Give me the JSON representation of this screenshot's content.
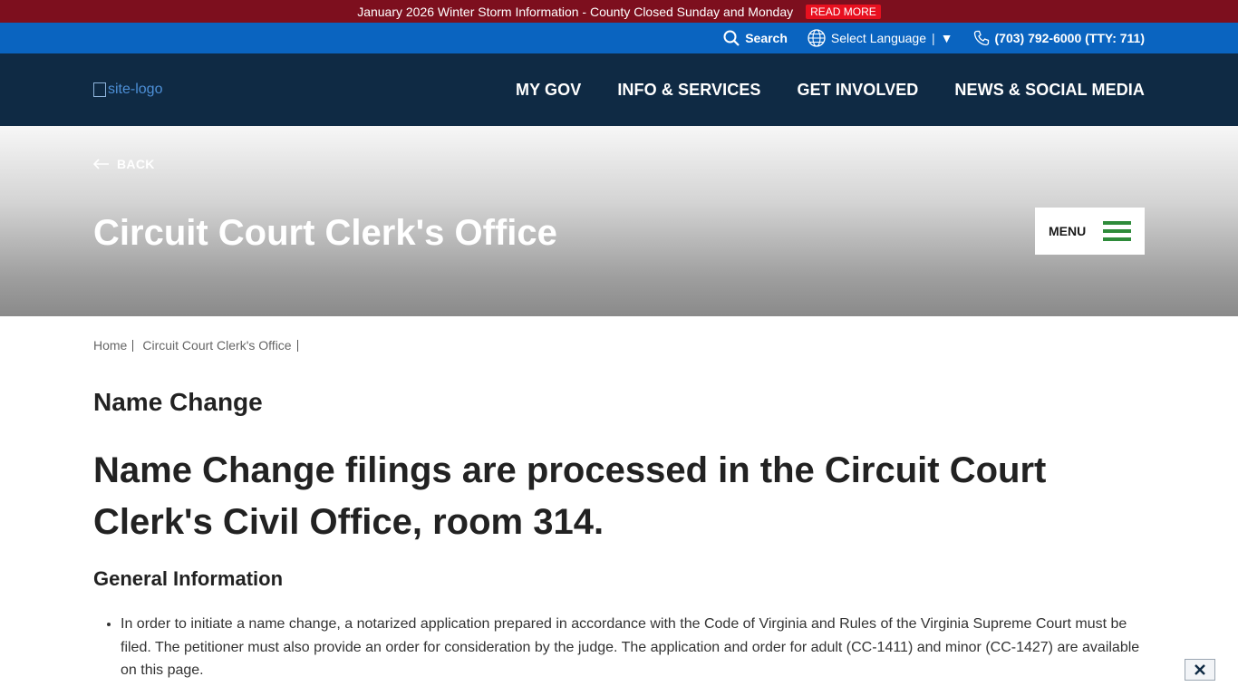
{
  "alert": {
    "text": "January 2026 Winter Storm Information - County Closed Sunday and Monday",
    "link_label": "READ MORE"
  },
  "utility": {
    "search_label": "Search",
    "language_label": "Select Language",
    "language_separator": "|",
    "language_arrow": "▼",
    "phone": "(703) 792-6000 (TTY: 711)"
  },
  "nav": {
    "logo_alt": "site-logo",
    "items": [
      {
        "label": "MY GOV"
      },
      {
        "label": "INFO & SERVICES"
      },
      {
        "label": "GET INVOLVED"
      },
      {
        "label": "NEWS & SOCIAL MEDIA"
      }
    ]
  },
  "hero": {
    "back_label": "BACK",
    "title": "Circuit Court Clerk's Office",
    "menu_label": "MENU"
  },
  "breadcrumb": [
    {
      "label": "Home"
    },
    {
      "label": "Circuit Court Clerk's Office"
    }
  ],
  "content": {
    "page_title": "Name Change",
    "lead_heading": "Name Change filings are processed in the Circuit Court Clerk's Civil Office, room 314.",
    "section_heading": "General Information",
    "list_items": [
      "In order to initiate a name change, a notarized application prepared in accordance with the Code of Virginia and Rules of the Virginia Supreme Court must be filed. The petitioner must also provide an order for consideration by the judge. The application and order for adult (CC-1411) and minor (CC-1427) are available on this page."
    ]
  },
  "colors": {
    "alert_bg": "#7d0f1e",
    "read_more_bg": "#e8101f",
    "utility_bg": "#0a64c0",
    "nav_bg": "#0f2a44",
    "menu_icon": "#2e8b3a"
  },
  "icons": {
    "search": "search-icon",
    "language": "globe-icon",
    "phone": "phone-icon",
    "back": "arrow-left-icon",
    "menu": "hamburger-icon",
    "close": "close-icon"
  }
}
